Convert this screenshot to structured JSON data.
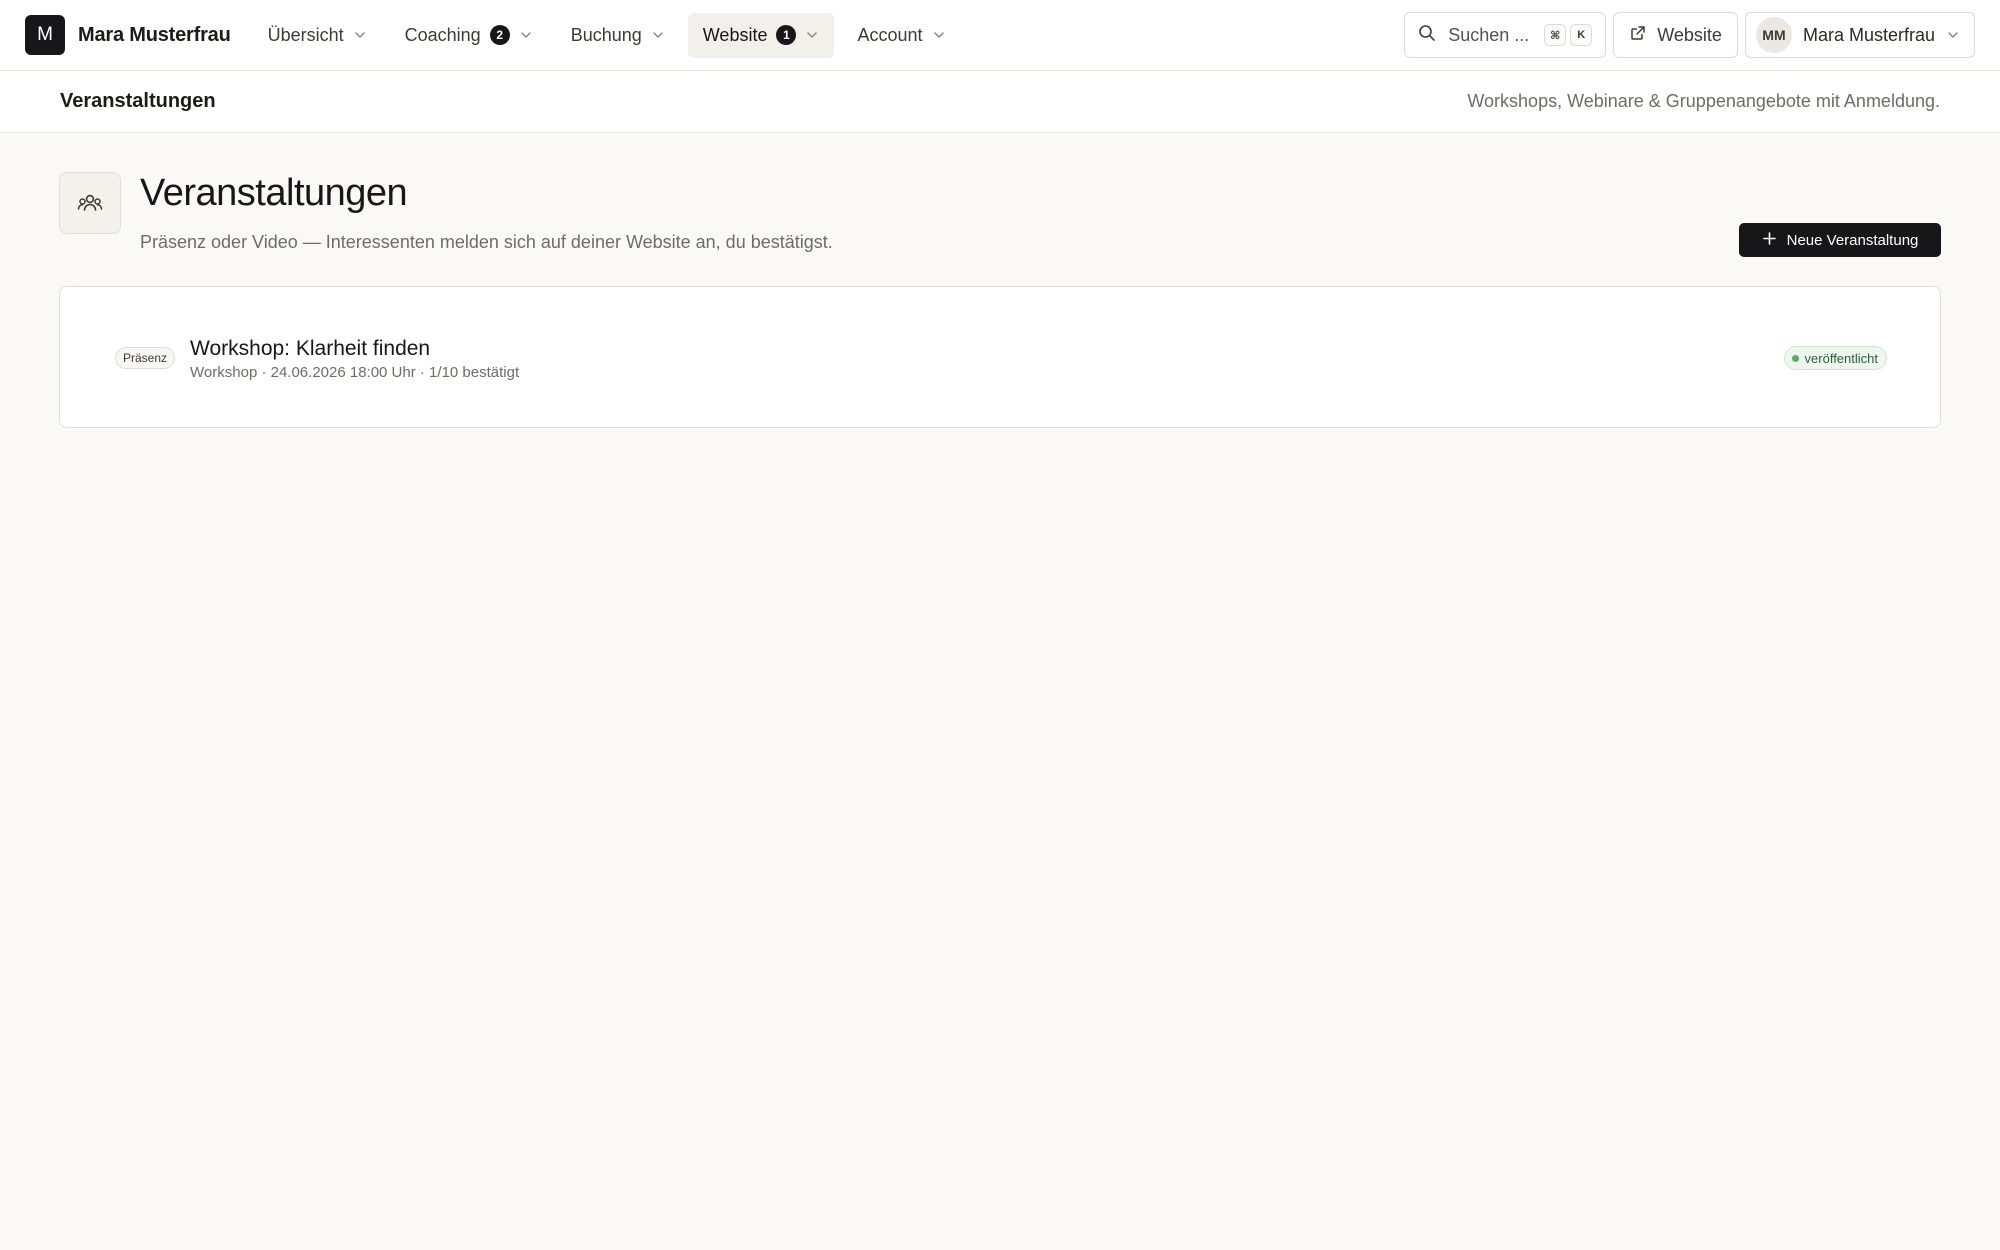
{
  "brand": {
    "initial": "M",
    "name": "Mara Musterfrau"
  },
  "nav": {
    "items": [
      {
        "label": "Übersicht",
        "badge": ""
      },
      {
        "label": "Coaching",
        "badge": "2"
      },
      {
        "label": "Buchung",
        "badge": ""
      },
      {
        "label": "Website",
        "badge": "1",
        "active": true
      },
      {
        "label": "Account",
        "badge": ""
      }
    ]
  },
  "search": {
    "placeholder": "Suchen ...",
    "kbd_mod": "⌘",
    "kbd_key": "K"
  },
  "website_link": {
    "label": "Website"
  },
  "user": {
    "initials": "MM",
    "name": "Mara Musterfrau"
  },
  "subheader": {
    "title": "Veranstaltungen",
    "description": "Workshops, Webinare & Gruppenangebote mit Anmeldung."
  },
  "page": {
    "title": "Veranstaltungen",
    "description": "Präsenz oder Video — Interessenten melden sich auf deiner Website an, du bestätigst.",
    "new_button": "Neue Veranstaltung"
  },
  "events": [
    {
      "type": "Präsenz",
      "title": "Workshop: Klarheit finden",
      "meta": "Workshop · 24.06.2026 18:00 Uhr · 1/10 bestätigt",
      "status": "veröffentlicht"
    }
  ],
  "colors": {
    "accent": "#17171a",
    "background": "#faf9f6",
    "status_green": "#5aa86a"
  }
}
